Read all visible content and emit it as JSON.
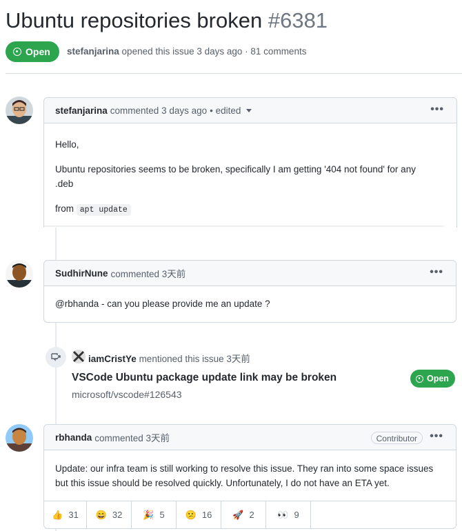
{
  "issue": {
    "title": "Ubuntu repositories broken",
    "number": "#6381",
    "state": "Open",
    "author": "stefanjarina",
    "meta_text": "opened this issue 3 days ago · 81 comments"
  },
  "comments": [
    {
      "author": "stefanjarina",
      "when": "commented 3 days ago",
      "edited": "• edited",
      "lines": [
        "Hello,",
        "Ubuntu repositories seems to be broken, specifically I am getting '404 not found' for any",
        ".deb",
        "from"
      ],
      "code": "apt update"
    },
    {
      "author": "SudhirNune",
      "when": "commented 3天前",
      "text": "@rbhanda - can you please provide me an update ?"
    },
    {
      "author": "rbhanda",
      "when": "commented 3天前",
      "role": "Contributor",
      "lines": [
        "Update: our infra team is still working to resolve this issue. They ran into some space issues",
        "but this issue should be resolved quickly. Unfortunately, I do not have an ETA yet."
      ],
      "reactions": [
        {
          "emoji": "👍",
          "count": "31"
        },
        {
          "emoji": "😄",
          "count": "32"
        },
        {
          "emoji": "🎉",
          "count": "5"
        },
        {
          "emoji": "😕",
          "count": "16"
        },
        {
          "emoji": "🚀",
          "count": "2"
        },
        {
          "emoji": "👀",
          "count": "9"
        }
      ]
    }
  ],
  "mention": {
    "user": "iamCristYe",
    "text": "mentioned this issue 3天前",
    "ref_title": "VSCode Ubuntu package update link may be broken",
    "ref_repo": "microsoft/vscode#126543",
    "ref_state": "Open"
  },
  "more_label": "•••",
  "colors": {
    "open_green": "#2da44e",
    "border": "#d0d7de",
    "header_bg": "#f6f8fa"
  }
}
